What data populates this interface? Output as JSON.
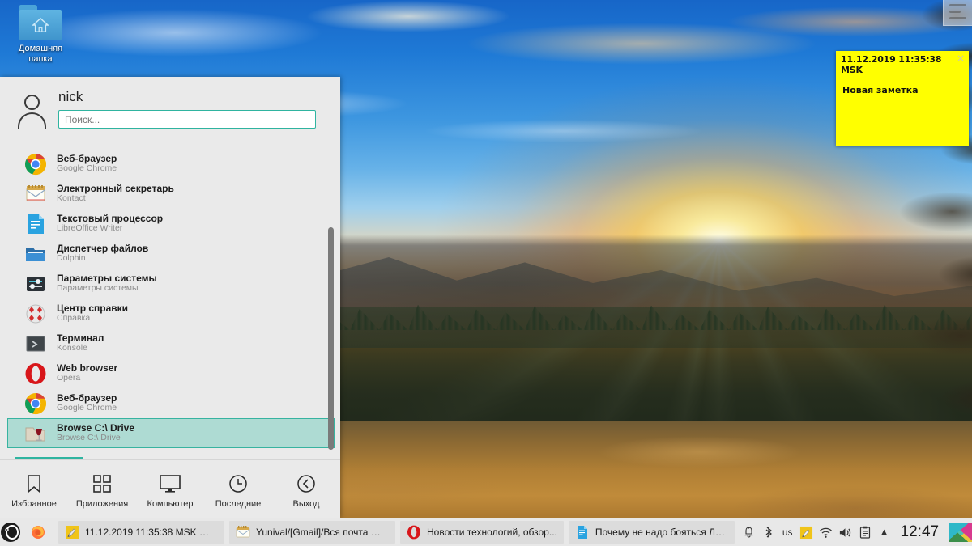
{
  "desktop": {
    "icons": [
      {
        "name": "home-folder",
        "label_line1": "Домашняя",
        "label_line2": "папка",
        "icon": "folder-home-icon"
      }
    ],
    "widget": {
      "name": "desktop-widget",
      "icon": "widget-panel-icon"
    }
  },
  "sticky_note": {
    "title": "11.12.2019 11:35:38 MSK",
    "body": "Новая заметка",
    "close_label": "×",
    "bg_color": "#ffff00"
  },
  "app_menu": {
    "user_name": "nick",
    "avatar_icon": "user-avatar-icon",
    "search": {
      "placeholder": "Поиск...",
      "value": "",
      "icon": "search-input"
    },
    "accent_color": "#2fb4a0",
    "bg_color": "#eaeaea",
    "apps": [
      {
        "title": "Веб-браузер",
        "sub": "Google Chrome",
        "icon": "chrome-icon",
        "selected": false
      },
      {
        "title": "Электронный секретарь",
        "sub": "Kontact",
        "icon": "kontact-icon",
        "selected": false
      },
      {
        "title": "Текстовый процессор",
        "sub": "LibreOffice Writer",
        "icon": "libreoffice-writer-icon",
        "selected": false
      },
      {
        "title": "Диспетчер файлов",
        "sub": "Dolphin",
        "icon": "dolphin-folder-icon",
        "selected": false
      },
      {
        "title": "Параметры системы",
        "sub": "Параметры системы",
        "icon": "system-settings-icon",
        "selected": false
      },
      {
        "title": "Центр справки",
        "sub": "Справка",
        "icon": "help-center-icon",
        "selected": false
      },
      {
        "title": "Терминал",
        "sub": "Konsole",
        "icon": "konsole-terminal-icon",
        "selected": false
      },
      {
        "title": "Web browser",
        "sub": "Opera",
        "icon": "opera-icon",
        "selected": false
      },
      {
        "title": "Веб-браузер",
        "sub": "Google Chrome",
        "icon": "chrome-icon",
        "selected": false
      },
      {
        "title": "Browse C:\\ Drive",
        "sub": "Browse C:\\ Drive",
        "icon": "wine-drive-icon",
        "selected": true
      }
    ],
    "tabs": [
      {
        "label": "Избранное",
        "icon": "bookmark-icon",
        "active": true
      },
      {
        "label": "Приложения",
        "icon": "grid-apps-icon",
        "active": false
      },
      {
        "label": "Компьютер",
        "icon": "monitor-icon",
        "active": false
      },
      {
        "label": "Последние",
        "icon": "clock-icon",
        "active": false
      },
      {
        "label": "Выход",
        "icon": "leave-back-icon",
        "active": false
      }
    ]
  },
  "taskbar": {
    "launcher": {
      "label": "",
      "icon": "opensuse-launcher-icon"
    },
    "pager": {
      "icon": "pager-widget",
      "desktops": 2,
      "active": 2
    },
    "tasks": [
      {
        "label": "",
        "icon": "firefox-icon",
        "minimized": true
      },
      {
        "label": "11.12.2019 11:35:38 MSK — K...",
        "icon": "knotes-icon"
      },
      {
        "label": "Yunival/[Gmail]/Вся почта — ...",
        "icon": "kontact-icon"
      },
      {
        "label": "Новости технологий, обзор...",
        "icon": "opera-icon"
      },
      {
        "label": "Почему не надо бояться Ли...",
        "icon": "libreoffice-writer-icon"
      }
    ],
    "tray": [
      {
        "name": "notifications-icon",
        "glyph": "🔔"
      },
      {
        "name": "bluetooth-icon",
        "glyph": ""
      },
      {
        "name": "keyboard-layout",
        "glyph": "us"
      },
      {
        "name": "knotes-tray-icon",
        "glyph": ""
      },
      {
        "name": "wifi-icon",
        "glyph": ""
      },
      {
        "name": "volume-icon",
        "glyph": ""
      },
      {
        "name": "clipboard-icon",
        "glyph": ""
      },
      {
        "name": "show-hidden-icon",
        "glyph": "▲"
      }
    ],
    "clock": "12:47",
    "colorful_icon": "color-widget-icon",
    "settings_icon": "sliders-icon"
  }
}
